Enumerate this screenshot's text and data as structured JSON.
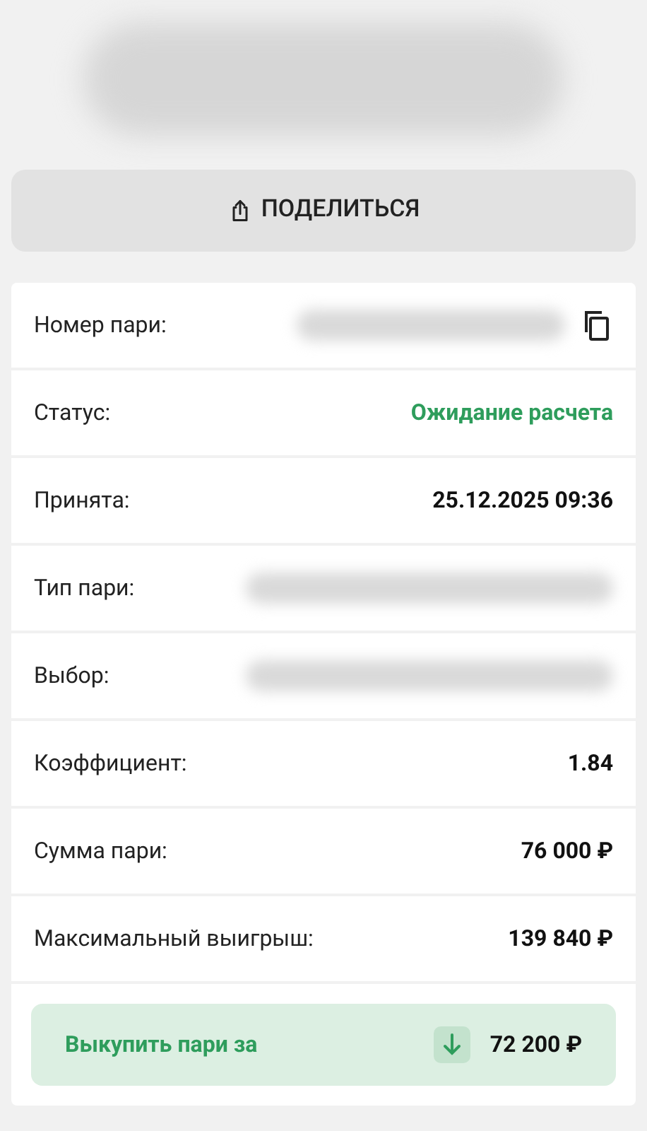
{
  "share_button": {
    "label": "ПОДЕЛИТЬСЯ"
  },
  "details": [
    {
      "label": "Номер пари:",
      "kind": "redacted_copy"
    },
    {
      "label": "Статус:",
      "kind": "status",
      "value": "Ожидание расчета"
    },
    {
      "label": "Принята:",
      "kind": "text",
      "value": "25.12.2025 09:36"
    },
    {
      "label": "Тип пари:",
      "kind": "redacted"
    },
    {
      "label": "Выбор:",
      "kind": "redacted"
    },
    {
      "label": "Коэффициент:",
      "kind": "text",
      "value": "1.84"
    },
    {
      "label": "Сумма пари:",
      "kind": "text",
      "value": "76 000 ₽"
    },
    {
      "label": "Максимальный выигрыш:",
      "kind": "text",
      "value": "139 840 ₽"
    }
  ],
  "cashout_button": {
    "label": "Выкупить пари за",
    "amount": "72 200 ₽"
  }
}
